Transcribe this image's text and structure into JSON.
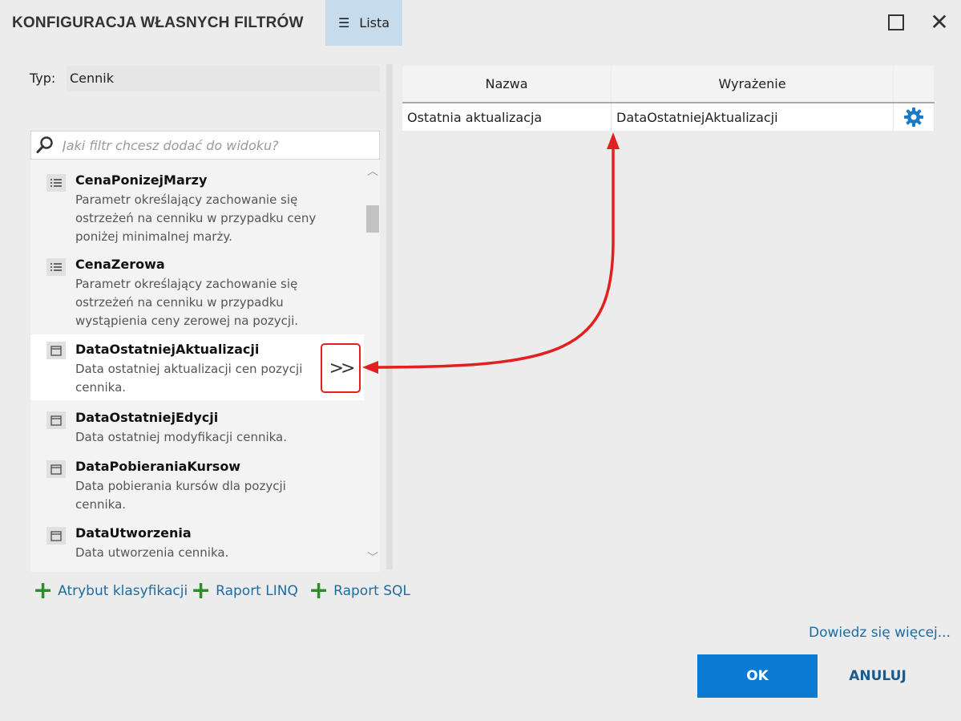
{
  "window": {
    "title": "KONFIGURACJA WŁASNYCH FILTRÓW",
    "view_tab": "Lista"
  },
  "type_field": {
    "label": "Typ:",
    "value": "Cennik"
  },
  "search": {
    "placeholder": "Jaki filtr chcesz dodać do widoku?"
  },
  "filters": [
    {
      "name": "CenaPonizejMarzy",
      "desc": "Parametr określający zachowanie się ostrzeżeń na cenniku w przypadku ceny poniżej minimalnej marży.",
      "icon": "list-icon"
    },
    {
      "name": "CenaZerowa",
      "desc": "Parametr określający zachowanie się ostrzeżeń na cenniku w przypadku wystąpienia ceny zerowej na pozycji.",
      "icon": "list-icon"
    },
    {
      "name": "DataOstatniejAktualizacji",
      "desc": "Data ostatniej aktualizacji cen pozycji cennika.",
      "icon": "calendar-icon",
      "selected": true
    },
    {
      "name": "DataOstatniejEdycji",
      "desc": "Data ostatniej modyfikacji cennika.",
      "icon": "calendar-icon"
    },
    {
      "name": "DataPobieraniaKursow",
      "desc": "Data pobierania kursów dla pozycji cennika.",
      "icon": "calendar-icon"
    },
    {
      "name": "DataUtworzenia",
      "desc": "Data utworzenia cennika.",
      "icon": "calendar-icon"
    }
  ],
  "add_button_label": ">>",
  "add_links": {
    "classification": "Atrybut klasyfikacji",
    "linq": "Raport LINQ",
    "sql": "Raport SQL"
  },
  "grid": {
    "headers": {
      "name": "Nazwa",
      "expression": "Wyrażenie"
    },
    "rows": [
      {
        "name": "Ostatnia aktualizacja",
        "expression": "DataOstatniejAktualizacji"
      }
    ]
  },
  "learn_more": "Dowiedz się więcej...",
  "buttons": {
    "ok": "OK",
    "cancel": "ANULUJ"
  },
  "colors": {
    "accent": "#0a7ad2",
    "highlight_arrow": "#e32020",
    "plus": "#2e8b2e",
    "link": "#1e6ca0"
  }
}
